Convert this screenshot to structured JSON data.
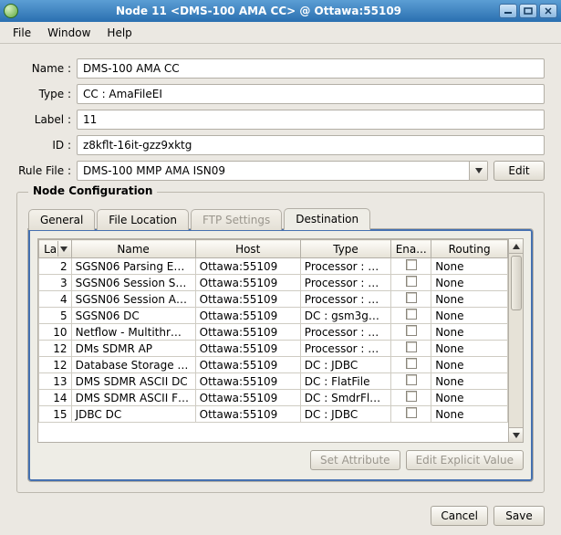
{
  "window": {
    "title": "Node 11 <DMS-100 AMA CC> @ Ottawa:55109"
  },
  "menu": {
    "file": "File",
    "window": "Window",
    "help": "Help"
  },
  "form": {
    "name_label": "Name :",
    "name_value": "DMS-100 AMA CC",
    "type_label": "Type :",
    "type_value": "CC : AmaFileEI",
    "label_label": "Label :",
    "label_value": "11",
    "id_label": "ID :",
    "id_value": "z8kflt-16it-gzz9xktg",
    "rulefile_label": "Rule File :",
    "rulefile_value": "DMS-100 MMP AMA ISN09",
    "edit_btn": "Edit"
  },
  "group": {
    "title": "Node Configuration"
  },
  "tabs": {
    "general": "General",
    "fileloc": "File Location",
    "ftp": "FTP Settings",
    "dest": "Destination"
  },
  "table": {
    "headers": {
      "la": "La...",
      "name": "Name",
      "host": "Host",
      "type": "Type",
      "ena": "Ena...",
      "routing": "Routing"
    },
    "rows": [
      {
        "la": "2",
        "name": "SGSN06 Parsing E…",
        "host": "Ottawa:55109",
        "type": "Processor : …",
        "routing": "None"
      },
      {
        "la": "3",
        "name": "SGSN06 Session S…",
        "host": "Ottawa:55109",
        "type": "Processor : …",
        "routing": "None"
      },
      {
        "la": "4",
        "name": "SGSN06 Session A…",
        "host": "Ottawa:55109",
        "type": "Processor : …",
        "routing": "None"
      },
      {
        "la": "5",
        "name": "SGSN06 DC",
        "host": "Ottawa:55109",
        "type": "DC : gsm3g…",
        "routing": "None"
      },
      {
        "la": "10",
        "name": "Netflow - Multithr…",
        "host": "Ottawa:55109",
        "type": "Processor : …",
        "routing": "None"
      },
      {
        "la": "12",
        "name": "DMs SDMR AP",
        "host": "Ottawa:55109",
        "type": "Processor : …",
        "routing": "None"
      },
      {
        "la": "12",
        "name": "Database Storage …",
        "host": "Ottawa:55109",
        "type": "DC : JDBC",
        "routing": "None"
      },
      {
        "la": "13",
        "name": "DMS SDMR ASCII DC",
        "host": "Ottawa:55109",
        "type": "DC : FlatFile",
        "routing": "None"
      },
      {
        "la": "14",
        "name": "DMS SDMR ASCII F…",
        "host": "Ottawa:55109",
        "type": "DC : SmdrFl…",
        "routing": "None"
      },
      {
        "la": "15",
        "name": "JDBC DC",
        "host": "Ottawa:55109",
        "type": "DC : JDBC",
        "routing": "None"
      }
    ]
  },
  "attr_buttons": {
    "set": "Set Attribute",
    "edit": "Edit Explicit Value"
  },
  "dialog_buttons": {
    "cancel": "Cancel",
    "save": "Save"
  }
}
